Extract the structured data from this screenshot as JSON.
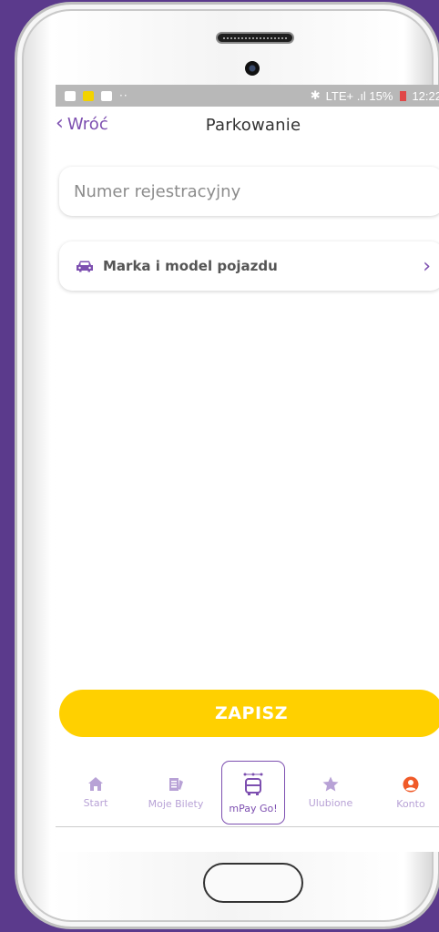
{
  "status_bar": {
    "right_text": "LTE+ .ıl 15%",
    "time": "12:22"
  },
  "header": {
    "back_label": "Wróć",
    "title": "Parkowanie"
  },
  "form": {
    "plate_placeholder": "Numer rejestracyjny",
    "plate_value": "",
    "vehicle_label": "Marka i model pojazdu"
  },
  "save_label": "ZAPISZ",
  "nav": {
    "items": [
      {
        "label": "Start",
        "icon": "home-icon"
      },
      {
        "label": "Moje Bilety",
        "icon": "tickets-icon"
      },
      {
        "label": "mPay Go!",
        "icon": "bus-icon"
      },
      {
        "label": "Ulubione",
        "icon": "star-icon"
      },
      {
        "label": "Konto",
        "icon": "user-icon"
      }
    ]
  },
  "colors": {
    "accent": "#7d4fb0",
    "save_button": "#ffd000",
    "nav_inactive": "#b8a2d6",
    "konto_icon": "#f05a28",
    "background": "#5b3a8c"
  }
}
